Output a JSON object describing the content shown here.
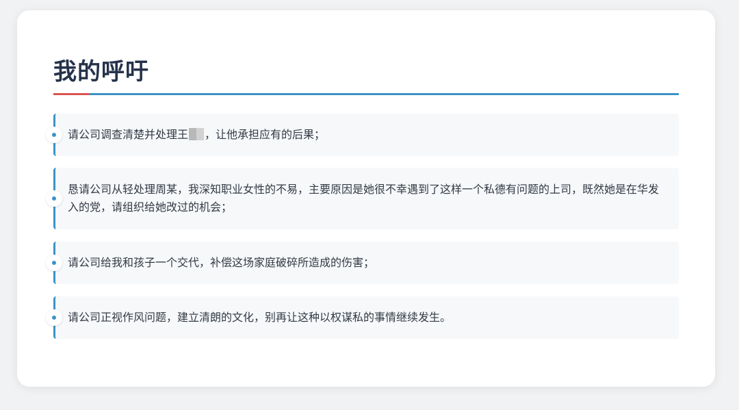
{
  "title": "我的呼吁",
  "colors": {
    "accent_blue": "#3c93c7",
    "accent_red": "#d9534f",
    "title_color": "#25324a"
  },
  "items": [
    {
      "before": "请公司调查清楚并处理王",
      "after": "，让他承担应有的后果；"
    },
    {
      "text": "恳请公司从轻处理周某，我深知职业女性的不易，主要原因是她很不幸遇到了这样一个私德有问题的上司，既然她是在华发入的党，请组织给她改过的机会；"
    },
    {
      "text": "请公司给我和孩子一个交代，补偿这场家庭破碎所造成的伤害；"
    },
    {
      "text": "请公司正视作风问题，建立清朗的文化，别再让这种以权谋私的事情继续发生。"
    }
  ]
}
